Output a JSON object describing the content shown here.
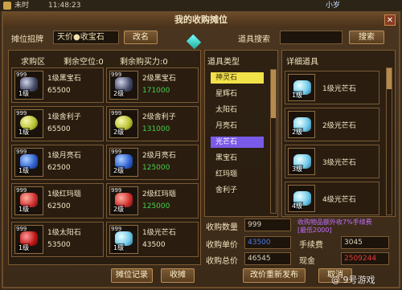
{
  "topbar": {
    "time_label": "未时",
    "clock": "11:48:23",
    "corner_text": "小岁",
    "title": "我的收购摊位"
  },
  "header": {
    "stall_sign_label": "摊位招牌",
    "stall_sign_value": "天价●收宝石",
    "rename_button": "改名",
    "item_search_label": "道具搜索",
    "item_search_value": "",
    "search_button": "搜索"
  },
  "grid": {
    "col1": "求购区",
    "col2": "剩余空位:0",
    "col3": "剩余购买力:0",
    "items": [
      {
        "name": "1级黑宝石",
        "price": "65500",
        "qty": "999",
        "level": "1级",
        "price_color": "normal",
        "gem": "black"
      },
      {
        "name": "2级黑宝石",
        "price": "171000",
        "qty": "999",
        "level": "2级",
        "price_color": "green",
        "gem": "black"
      },
      {
        "name": "1级舍利子",
        "price": "65500",
        "qty": "999",
        "level": "1级",
        "price_color": "normal",
        "gem": "pearl"
      },
      {
        "name": "2级舍利子",
        "price": "131000",
        "qty": "999",
        "level": "2级",
        "price_color": "green",
        "gem": "pearl"
      },
      {
        "name": "1级月亮石",
        "price": "62500",
        "qty": "999",
        "level": "1级",
        "price_color": "normal",
        "gem": "blue"
      },
      {
        "name": "2级月亮石",
        "price": "125000",
        "qty": "999",
        "level": "2级",
        "price_color": "green",
        "gem": "blue"
      },
      {
        "name": "1级红玛瑙",
        "price": "62500",
        "qty": "999",
        "level": "1级",
        "price_color": "normal",
        "gem": "red"
      },
      {
        "name": "2级红玛瑙",
        "price": "125000",
        "qty": "999",
        "level": "2级",
        "price_color": "green",
        "gem": "red"
      },
      {
        "name": "1级太阳石",
        "price": "53500",
        "qty": "999",
        "level": "1级",
        "price_color": "normal",
        "gem": "red2"
      },
      {
        "name": "1级光芒石",
        "price": "43500",
        "qty": "999",
        "level": "1级",
        "price_color": "normal",
        "gem": "diamond"
      }
    ]
  },
  "types": {
    "header": "道具类型",
    "items": [
      "神灵石",
      "星辉石",
      "太阳石",
      "月亮石",
      "光芒石",
      "黑宝石",
      "红玛瑙",
      "舍利子"
    ],
    "selected_yellow": "神灵石",
    "selected_purple": "光芒石"
  },
  "details": {
    "header": "详细道具",
    "items": [
      {
        "name": "1级光芒石",
        "level": "1级"
      },
      {
        "name": "2级光芒石",
        "level": "2级"
      },
      {
        "name": "3级光芒石",
        "level": "3级"
      },
      {
        "name": "4级光芒石",
        "level": "4级"
      }
    ]
  },
  "stats": {
    "qty_label": "收购数量",
    "qty_value": "999",
    "note_line1": "收购物品额外收7%手续费",
    "note_line2": "[最低2000]",
    "unit_label": "收购单价",
    "unit_value": "43500",
    "fee_label": "手续费",
    "fee_value": "3045",
    "total_label": "收购总价",
    "total_value": "46545",
    "cash_label": "现金",
    "cash_value": "2509244"
  },
  "buttons": {
    "record": "摊位记录",
    "close_stall": "收摊",
    "republish": "改价重新发布",
    "cancel": "取消"
  },
  "watermark": "@ 9号游戏",
  "colors": {
    "green_price": "#47d04a",
    "cash_red": "#d83030",
    "unit_blue": "#2a60c8"
  }
}
